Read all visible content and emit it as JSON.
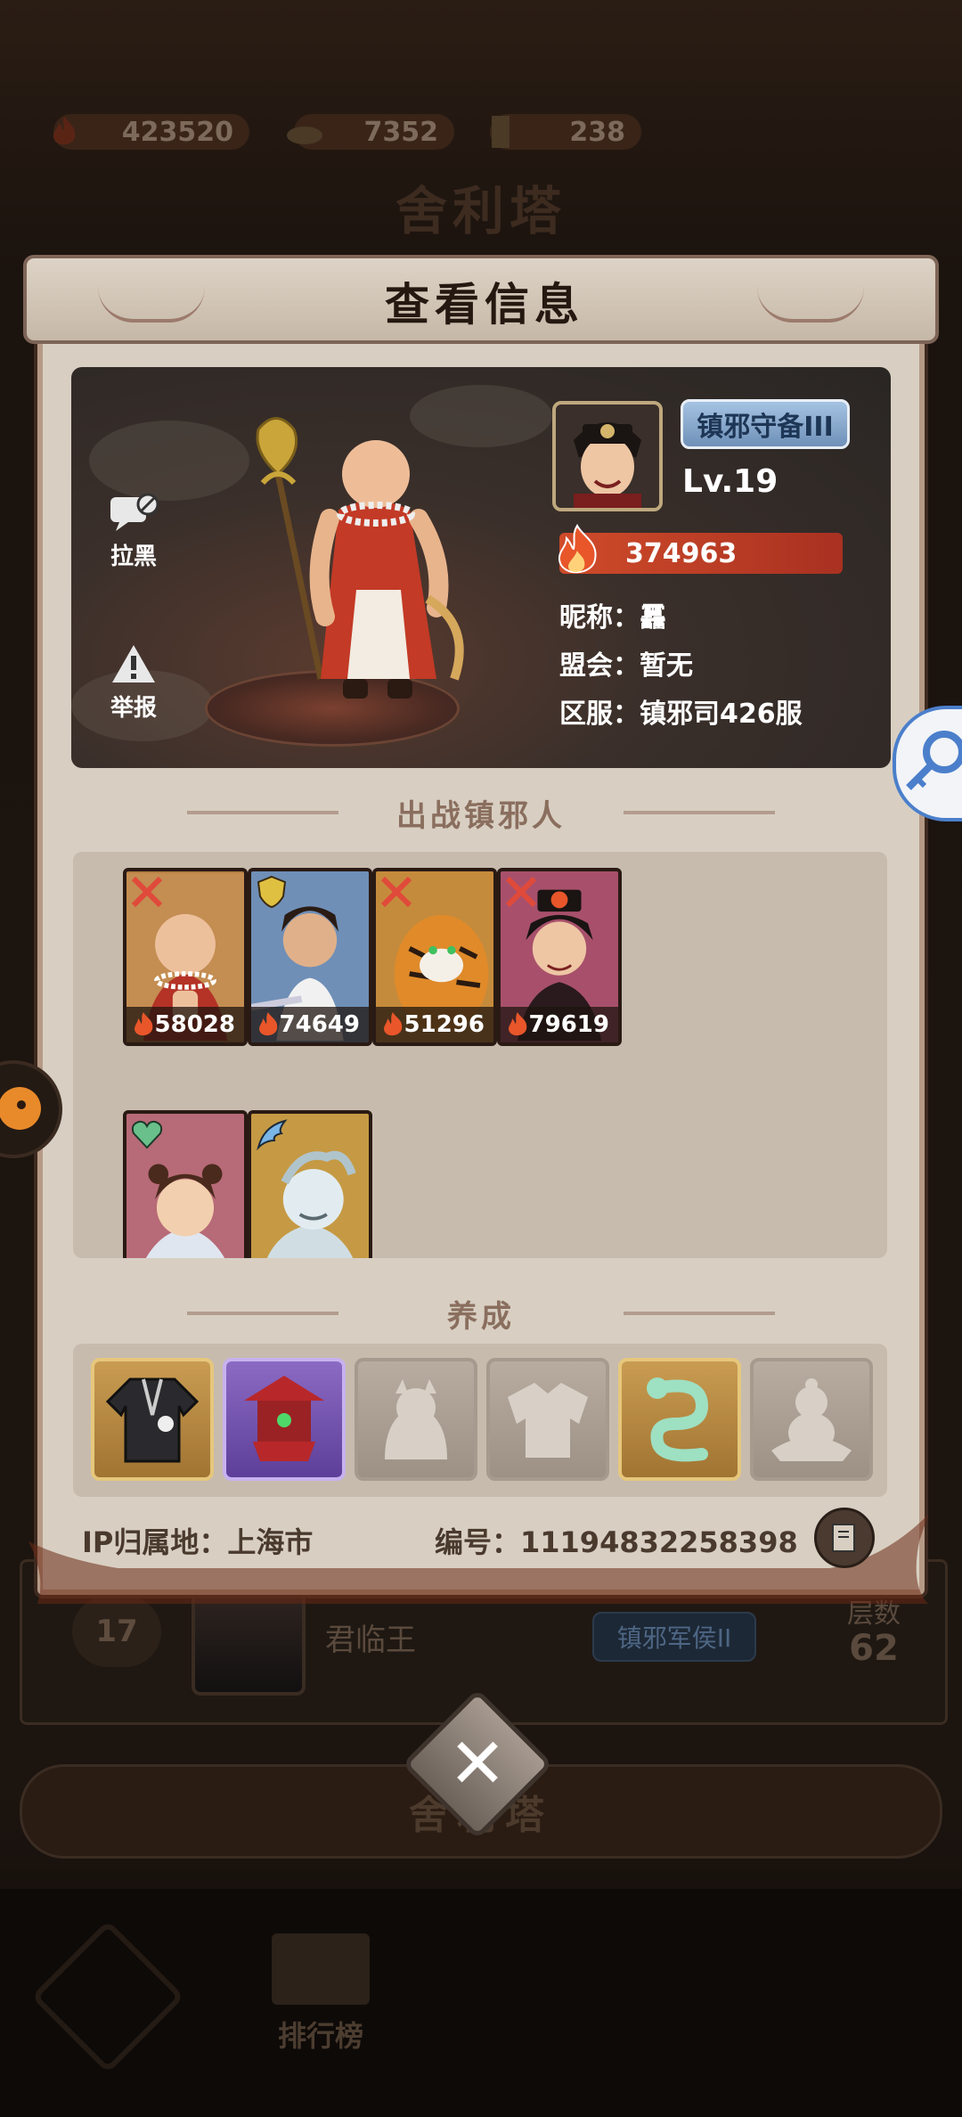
{
  "background": {
    "resources": [
      {
        "icon": "flame-icon",
        "value": "423520"
      },
      {
        "icon": "ingot-icon",
        "value": "7352"
      },
      {
        "icon": "talisman-icon",
        "value": "238"
      }
    ],
    "page_title": "舍利塔",
    "row": {
      "rank": "17",
      "name": "君临王",
      "badge": "镇邪军侯II",
      "layer_label": "层数",
      "layer_value": "62"
    },
    "main_button": "舍利塔",
    "nav": {
      "rank_label": "排行榜"
    }
  },
  "modal": {
    "title": "查看信息",
    "profile": {
      "block_label": "拉黑",
      "report_label": "举报",
      "rank_badge": "镇邪守备III",
      "level": "Lv.19",
      "power": "374963",
      "nickname": "昵称：",
      "nickname_value": "靐",
      "guild": "盟会：",
      "guild_value": "暂无",
      "server": "区服：",
      "server_value": "镇邪司426服"
    },
    "heroes_section": "出战镇邪人",
    "heroes": [
      {
        "power": "58028",
        "tag": "crossed-swords-icon",
        "frame": "#b37c40"
      },
      {
        "power": "74649",
        "tag": "shield-icon",
        "frame": "#6f8fb7"
      },
      {
        "power": "51296",
        "tag": "crossed-swords-icon",
        "frame": "#c58b3c"
      },
      {
        "power": "79619",
        "tag": "crossed-swords-icon",
        "frame": "#a8506b"
      },
      {
        "power": "",
        "tag": "heart-icon",
        "frame": "#b76a77"
      },
      {
        "power": "",
        "tag": "wing-icon",
        "frame": "#c69a44"
      }
    ],
    "cultivation_section": "养成",
    "cultivation": [
      {
        "name": "robe-icon",
        "style": "gold"
      },
      {
        "name": "pavilion-icon",
        "style": "purple"
      },
      {
        "name": "beast-icon",
        "style": "grey"
      },
      {
        "name": "armor-icon",
        "style": "grey"
      },
      {
        "name": "dragon-jade-icon",
        "style": "gold"
      },
      {
        "name": "buddha-icon",
        "style": "grey"
      }
    ],
    "ip_label": "IP归属地：上海市",
    "id_label": "编号：11194832258398"
  }
}
